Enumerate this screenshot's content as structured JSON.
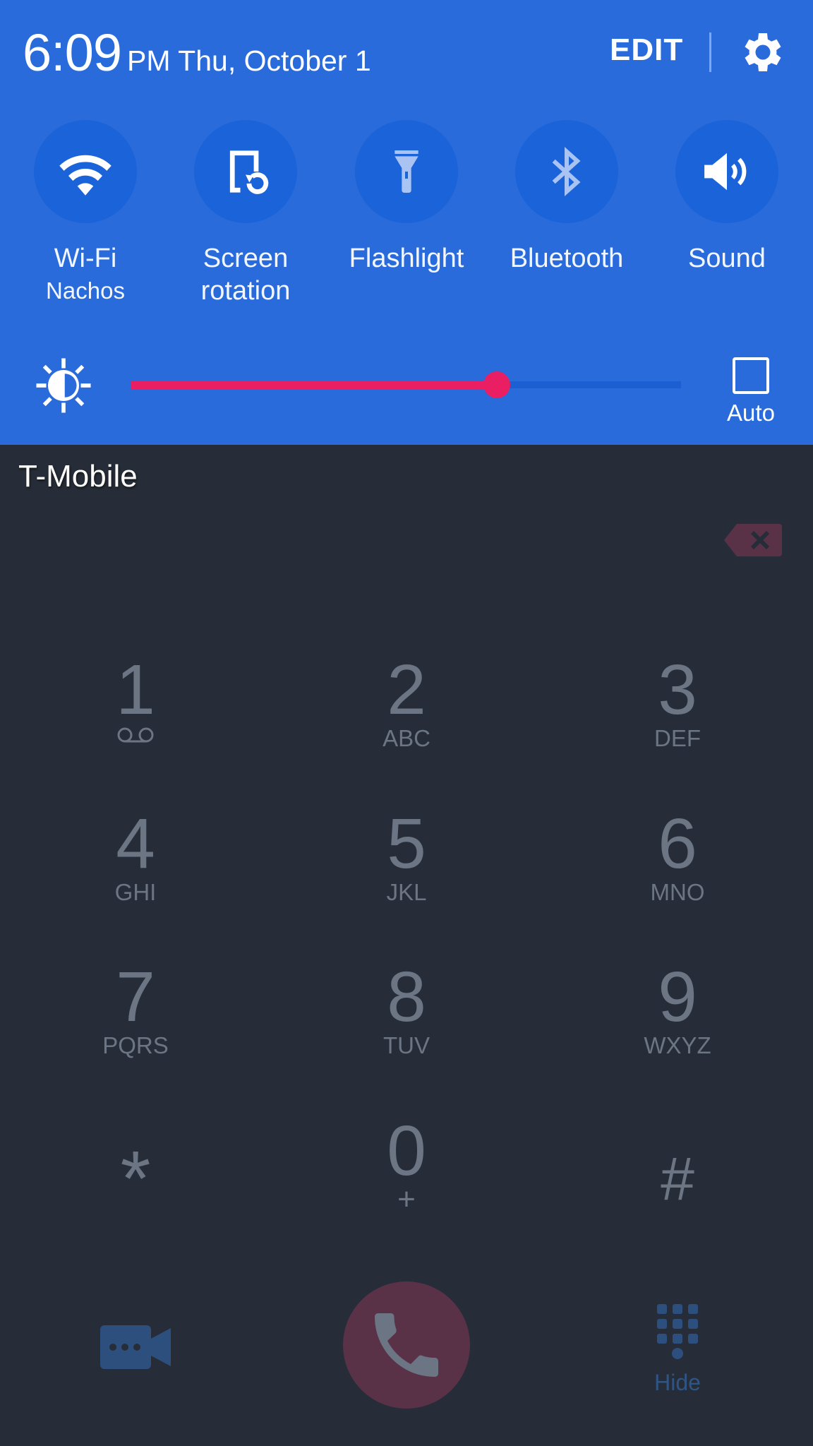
{
  "status": {
    "time": "6:09",
    "ampm_date": "PM Thu, October 1",
    "edit_label": "EDIT",
    "settings_icon": "gear-icon"
  },
  "quick_settings": [
    {
      "label": "Wi-Fi",
      "sub": "Nachos",
      "icon": "wifi-icon",
      "active": true
    },
    {
      "label": "Screen",
      "sub": "rotation",
      "icon": "screen-rotation-icon",
      "active": true
    },
    {
      "label": "Flashlight",
      "sub": "",
      "icon": "flashlight-icon",
      "active": false
    },
    {
      "label": "Bluetooth",
      "sub": "",
      "icon": "bluetooth-icon",
      "active": false
    },
    {
      "label": "Sound",
      "sub": "",
      "icon": "sound-icon",
      "active": true
    }
  ],
  "brightness": {
    "level": 0.665,
    "auto_label": "Auto",
    "auto_checked": false
  },
  "dialer": {
    "carrier": "T-Mobile",
    "keys": [
      {
        "digit": "1",
        "letters": ""
      },
      {
        "digit": "2",
        "letters": "ABC"
      },
      {
        "digit": "3",
        "letters": "DEF"
      },
      {
        "digit": "4",
        "letters": "GHI"
      },
      {
        "digit": "5",
        "letters": "JKL"
      },
      {
        "digit": "6",
        "letters": "MNO"
      },
      {
        "digit": "7",
        "letters": "PQRS"
      },
      {
        "digit": "8",
        "letters": "TUV"
      },
      {
        "digit": "9",
        "letters": "WXYZ"
      },
      {
        "digit": "*",
        "letters": ""
      },
      {
        "digit": "0",
        "letters": "+"
      },
      {
        "digit": "#",
        "letters": ""
      }
    ],
    "hide_label": "Hide"
  },
  "colors": {
    "panel_bg": "#2a6bdc",
    "tile_bg": "#1b63d8",
    "slider_accent": "#e91e63",
    "dialer_bg": "#272d38",
    "key_text": "#6b7583",
    "call_button": "#5a3248"
  }
}
